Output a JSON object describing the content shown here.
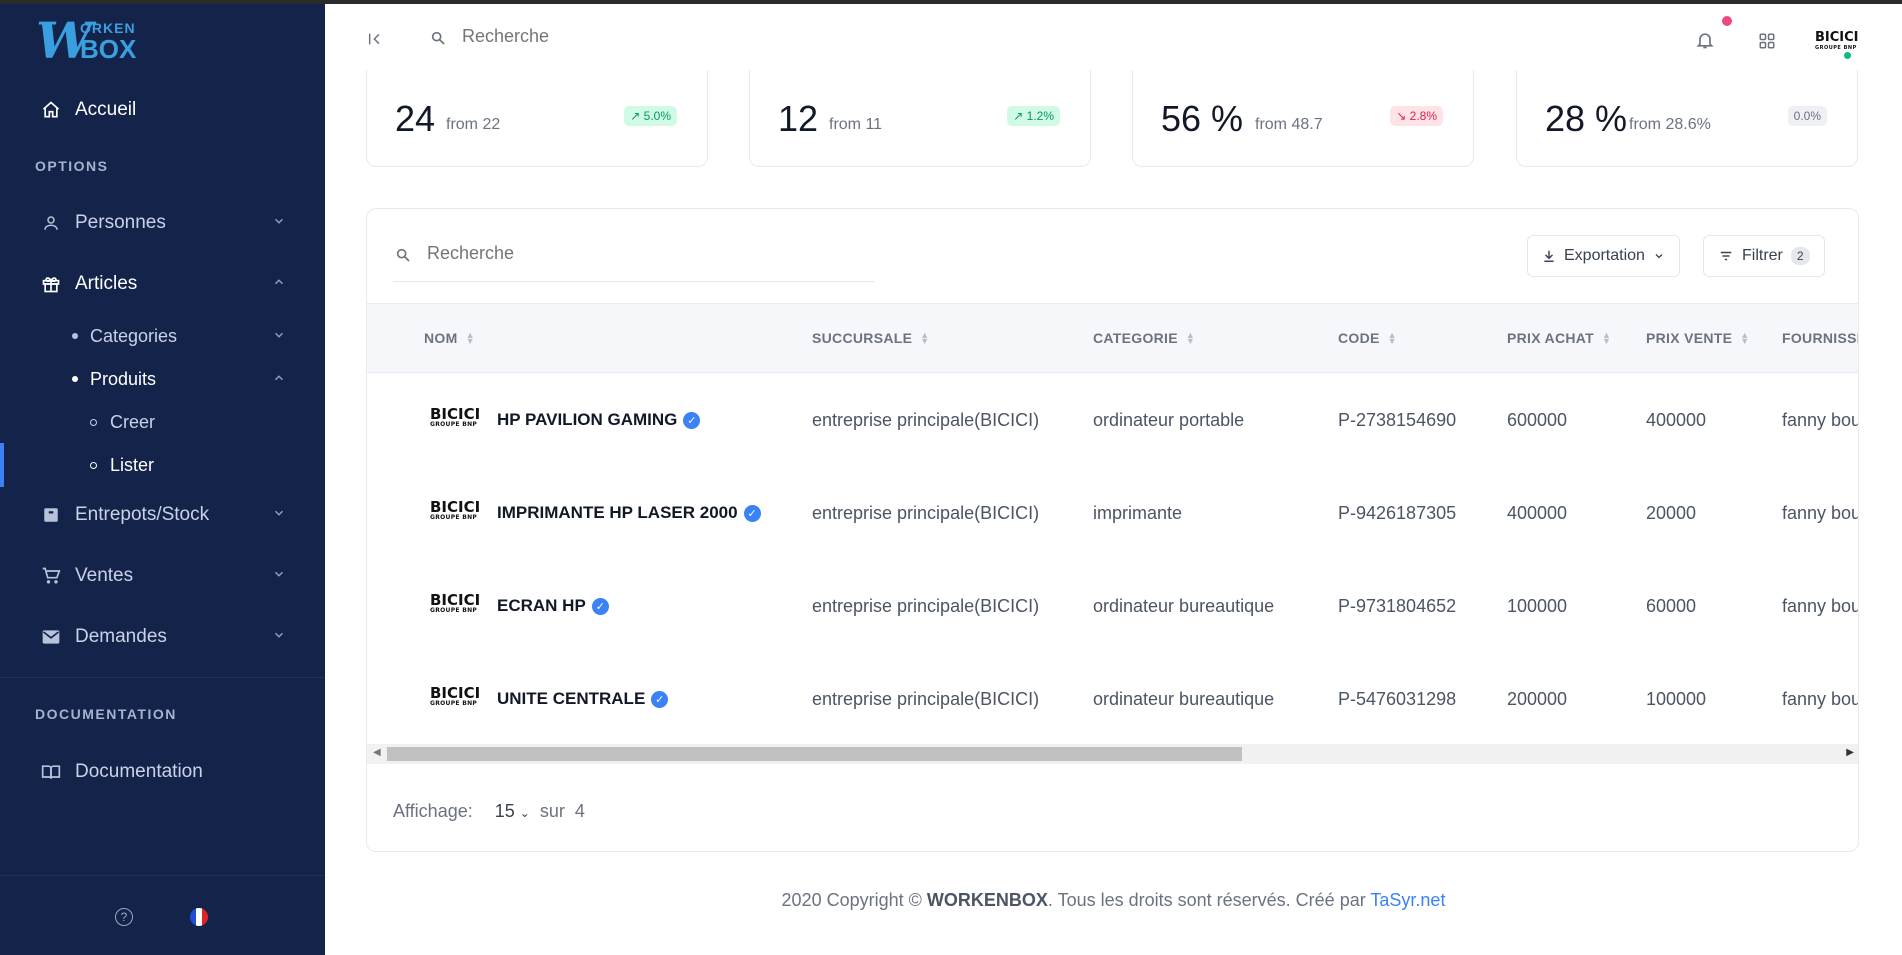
{
  "app": {
    "logo_top": "ORKEN",
    "logo_letter": "W",
    "logo_bottom": "BOX"
  },
  "sidebar": {
    "home": "Accueil",
    "options_label": "OPTIONS",
    "items": [
      {
        "label": "Personnes",
        "icon": "user-icon"
      },
      {
        "label": "Articles",
        "icon": "gift-icon"
      },
      {
        "label": "Categories"
      },
      {
        "label": "Produits"
      },
      {
        "label": "Creer"
      },
      {
        "label": "Lister"
      },
      {
        "label": "Entrepots/Stock",
        "icon": "archive-icon"
      },
      {
        "label": "Ventes",
        "icon": "cart-icon"
      },
      {
        "label": "Demandes",
        "icon": "mail-icon"
      }
    ],
    "doc_label": "DOCUMENTATION",
    "doc_item": "Documentation",
    "flag_colors": [
      "#1d4ed8",
      "#ffffff",
      "#dc2626"
    ]
  },
  "header": {
    "search_placeholder": "Recherche",
    "user_logo": "BICICI",
    "user_logo_sub": "GROUPE BNP",
    "notification_dot_color": "#ec4c7b"
  },
  "stats": [
    {
      "value": "24",
      "from": "from 22",
      "badge": "5.0%",
      "trend": "up"
    },
    {
      "value": "12",
      "from": "from 11",
      "badge": "1.2%",
      "trend": "up"
    },
    {
      "value": "56 %",
      "from": "from 48.7",
      "badge": "2.8%",
      "trend": "down"
    },
    {
      "value": "28 %",
      "from": "from 28.6%",
      "badge": "0.0%",
      "trend": "neutral"
    }
  ],
  "table": {
    "search_placeholder": "Recherche",
    "export_label": "Exportation",
    "filter_label": "Filtrer",
    "filter_count": "2",
    "columns": [
      "NOM",
      "SUCCURSALE",
      "CATEGORIE",
      "CODE",
      "PRIX ACHAT",
      "PRIX VENTE",
      "FOURNISSI"
    ],
    "rows": [
      {
        "logo": "BICICI",
        "logo_sub": "GROUPE BNP",
        "nom": "HP PAVILION GAMING",
        "succursale": "entreprise principale(BICICI)",
        "categorie": "ordinateur portable",
        "code": "P-2738154690",
        "prix_achat": "600000",
        "prix_vente": "400000",
        "fournisseur": "fanny bou"
      },
      {
        "logo": "BICICI",
        "logo_sub": "GROUPE BNP",
        "nom": "IMPRIMANTE HP LASER 2000",
        "succursale": "entreprise principale(BICICI)",
        "categorie": "imprimante",
        "code": "P-9426187305",
        "prix_achat": "400000",
        "prix_vente": "20000",
        "fournisseur": "fanny bou"
      },
      {
        "logo": "BICICI",
        "logo_sub": "GROUPE BNP",
        "nom": "ECRAN HP",
        "succursale": "entreprise principale(BICICI)",
        "categorie": "ordinateur bureautique",
        "code": "P-9731804652",
        "prix_achat": "100000",
        "prix_vente": "60000",
        "fournisseur": "fanny bou"
      },
      {
        "logo": "BICICI",
        "logo_sub": "GROUPE BNP",
        "nom": "UNITE CENTRALE",
        "succursale": "entreprise principale(BICICI)",
        "categorie": "ordinateur bureautique",
        "code": "P-5476031298",
        "prix_achat": "200000",
        "prix_vente": "100000",
        "fournisseur": "fanny bou"
      }
    ],
    "pager_label": "Affichage:",
    "pager_value": "15",
    "pager_of": "sur",
    "pager_total": "4"
  },
  "footer": {
    "prefix": "2020 Copyright ©",
    "brand": "WORKENBOX",
    "middle": ". Tous les droits sont réservés. Créé par",
    "link": "TaSyr.net"
  }
}
